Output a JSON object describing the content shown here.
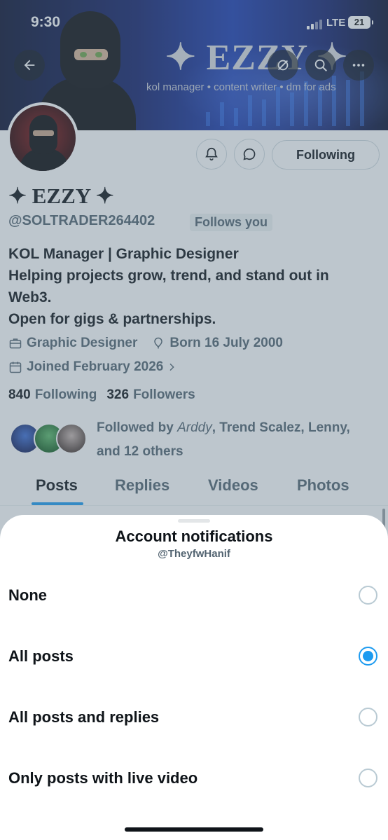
{
  "status_bar": {
    "time": "9:30",
    "network": "LTE",
    "battery": "21"
  },
  "banner": {
    "title": "✦ EZZY ✦",
    "subtitle": "kol manager • content writer • dm for ads"
  },
  "profile": {
    "name": "✦ EZZY ✦",
    "handle": "@SOLTRADER264402",
    "follows_you": "Follows you",
    "following_button": "Following",
    "bio": [
      "KOL Manager | Graphic Designer",
      "Helping projects grow, trend, and stand out in",
      "Web3.",
      "Open for gigs & partnerships."
    ],
    "category": "Graphic Designer",
    "born": "Born 16 July 2000",
    "joined": "Joined February 2026",
    "following_count": "840",
    "following_label": "Following",
    "followers_count": "326",
    "followers_label": "Followers",
    "followed_by_prefix": "Followed by ",
    "followed_by_first": "Arddy",
    "followed_by_rest": ", Trend Scalez, Lenny,",
    "followed_by_line2": "and 12 others"
  },
  "tabs": [
    "Posts",
    "Replies",
    "Videos",
    "Photos"
  ],
  "sheet": {
    "title": "Account notifications",
    "subtitle": "@TheyfwHanif",
    "options": [
      {
        "label": "None",
        "selected": false
      },
      {
        "label": "All posts",
        "selected": true
      },
      {
        "label": "All posts and replies",
        "selected": false
      },
      {
        "label": "Only posts with live video",
        "selected": false
      }
    ]
  },
  "colors": {
    "accent": "#1d9bf0",
    "text": "#0f1419",
    "secondary": "#536471"
  }
}
